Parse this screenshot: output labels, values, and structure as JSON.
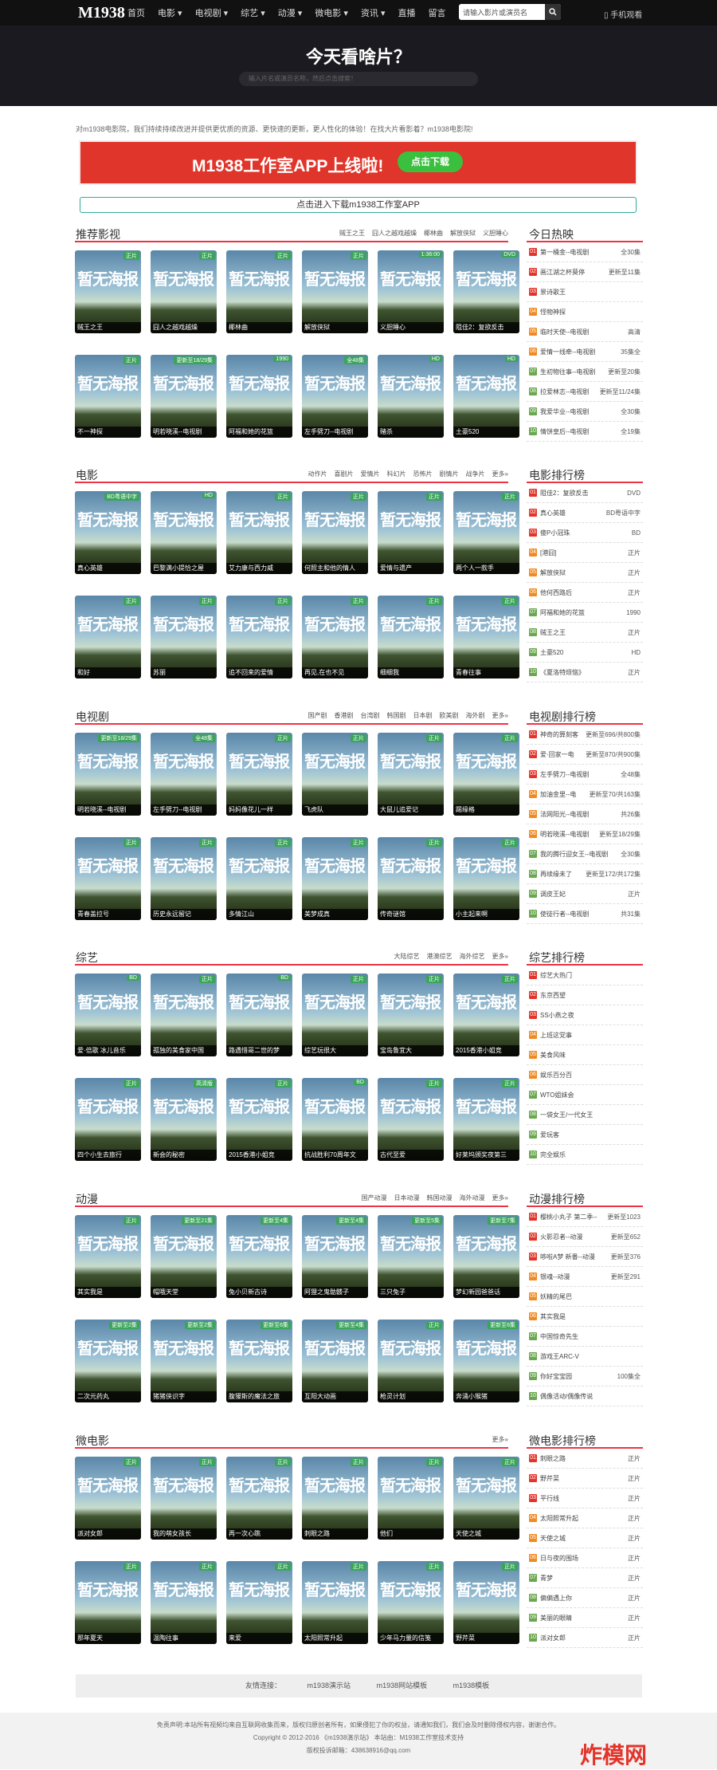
{
  "nav": {
    "logo": "M1938",
    "items": [
      "首页",
      "电影 ▾",
      "电视剧 ▾",
      "综艺 ▾",
      "动漫 ▾",
      "微电影 ▾",
      "资讯 ▾",
      "直播",
      "留言"
    ],
    "search_placeholder": "请输入影片或演员名",
    "mobile": "▯ 手机观看"
  },
  "hero": {
    "title": "今天看啥片？",
    "search": "输入片名或演员名称，然后点击搜索！"
  },
  "notice": "对m1938电影院，我们持续持续改进并提供更优质的资源、更快速的更新，更人性化的体验！在找大片看影着？m1938电影院!",
  "banner": {
    "text": "M1938工作室APP上线啦!",
    "button": "点击下载"
  },
  "download": "点击进入下载m1938工作室APP",
  "poster_text": "暂无海报",
  "sections": [
    {
      "title": "推荐影视",
      "tags": [
        "贼王之王",
        "囧人之越戏越燥",
        "椰林曲",
        "解放侠狱",
        "义胆睡心"
      ],
      "cards": [
        [
          "贼王之王",
          "正片"
        ],
        [
          "囧人之越戏越燥",
          "正片"
        ],
        [
          "椰林曲",
          "正片"
        ],
        [
          "解放侠狱",
          "正片"
        ],
        [
          "义胆睡心",
          "1:36:00"
        ],
        [
          "阻佳2：复欲反击",
          "DVD"
        ],
        [
          "不一神探",
          "正片"
        ],
        [
          "明若晓溪--电视剧",
          "更新至18/29集"
        ],
        [
          "阿福和她的花篮",
          "1990"
        ],
        [
          "左手劈刀--电视剧",
          "全48集"
        ],
        [
          "赌杀",
          "HD"
        ],
        [
          "土豪520",
          "HD"
        ]
      ]
    },
    {
      "title": "电影",
      "tags": [
        "动作片",
        "喜剧片",
        "爱情片",
        "科幻片",
        "恐怖片",
        "剧情片",
        "战争片",
        "更多»"
      ],
      "cards": [
        [
          "真心英雄",
          "BD粤语中字"
        ],
        [
          "巴黎满小提恰之屋",
          "HD"
        ],
        [
          "艾力康与西力威",
          "正片"
        ],
        [
          "何照主和他的情人",
          "正片"
        ],
        [
          "爱情与遗产",
          "正片"
        ],
        [
          "两个人一款手",
          "正片"
        ],
        [
          "和好",
          "正片"
        ],
        [
          "苏丽",
          "正片"
        ],
        [
          "追不回来的爱情",
          "正片"
        ],
        [
          "再见,在也不见",
          "正片"
        ],
        [
          "细细我",
          "正片"
        ],
        [
          "青春往事",
          "正片"
        ]
      ]
    },
    {
      "title": "电视剧",
      "tags": [
        "国产剧",
        "香港剧",
        "台湾剧",
        "韩国剧",
        "日本剧",
        "欧美剧",
        "海外剧",
        "更多»"
      ],
      "cards": [
        [
          "明若晓溪--电视剧",
          "更新至18/29集"
        ],
        [
          "左手劈刀--电视剧",
          "全48集"
        ],
        [
          "妈妈像花儿一样",
          "正片"
        ],
        [
          "飞虎队",
          "正片"
        ],
        [
          "大鼠儿追爱记",
          "正片"
        ],
        [
          "踢缘格",
          "正片"
        ],
        [
          "青春盖拉号",
          "正片"
        ],
        [
          "历史永远留记",
          "正片"
        ],
        [
          "多情江山",
          "正片"
        ],
        [
          "美梦成真",
          "正片"
        ],
        [
          "传奇谜馆",
          "正片"
        ],
        [
          "小主起来啊",
          "正片"
        ]
      ]
    },
    {
      "title": "综艺",
      "tags": [
        "大陆综艺",
        "港澳综艺",
        "海外综艺",
        "更多»"
      ],
      "cards": [
        [
          "爱·倍歌 冰儿音乐",
          "BD"
        ],
        [
          "孤独的美食家中国",
          "正片"
        ],
        [
          "路遇惜哥二世的梦",
          "BD"
        ],
        [
          "综艺玩很大",
          "正片"
        ],
        [
          "宝岛鲁宜大",
          "正片"
        ],
        [
          "2015香港小姐竞",
          "正片"
        ],
        [
          "四个小生去旅行",
          "正片"
        ],
        [
          "新会的秘密",
          "高清版"
        ],
        [
          "2015香港小姐竞",
          "正片"
        ],
        [
          "抗战胜利70周年文",
          "BD"
        ],
        [
          "古代至爱",
          "正片"
        ],
        [
          "好莱坞颁奖夜第三",
          "正片"
        ]
      ]
    },
    {
      "title": "动漫",
      "tags": [
        "国产动漫",
        "日本动漫",
        "韩国动漫",
        "海外动漫",
        "更多»"
      ],
      "cards": [
        [
          "其实我是",
          "正片"
        ],
        [
          "帽哦天堂",
          "更新至21集"
        ],
        [
          "兔小贝新古诗",
          "更新至4集"
        ],
        [
          "阿狸之鬼骷髅子",
          "更新至4集"
        ],
        [
          "三只兔子",
          "更新至5集"
        ],
        [
          "梦幻新园爸爸话",
          "更新至7集"
        ],
        [
          "二次元药丸",
          "更新至2集"
        ],
        [
          "猪猪侠识字",
          "更新至2集"
        ],
        [
          "腹獴斯的魔法之旅",
          "更新至6集"
        ],
        [
          "互阳大动画",
          "更新至4集"
        ],
        [
          "枪灵计划",
          "正片"
        ],
        [
          "奔涌小猴猪",
          "更新至6集"
        ]
      ]
    },
    {
      "title": "微电影",
      "tags": [
        "更多»"
      ],
      "cards": [
        [
          "派对女郎",
          "正片"
        ],
        [
          "我的萌女孩长",
          "正片"
        ],
        [
          "再一次心跳",
          "正片"
        ],
        [
          "刺眼之路",
          "正片"
        ],
        [
          "他们",
          "正片"
        ],
        [
          "天使之城",
          "正片"
        ],
        [
          "那年夏天",
          "正片"
        ],
        [
          "温陶往事",
          "正片"
        ],
        [
          "来爱",
          "正片"
        ],
        [
          "太阳照常升起",
          "正片"
        ],
        [
          "少年马力量的信笺",
          "正片"
        ],
        [
          "野芹菜",
          "正片"
        ]
      ]
    }
  ],
  "ranks": [
    {
      "title": "今日热映",
      "items": [
        [
          "第一桶金--电视剧",
          "全30集"
        ],
        [
          "画江湖之杯莫停",
          "更新至11集"
        ],
        [
          "景诗歌王",
          ""
        ],
        [
          "怪物神探",
          ""
        ],
        [
          "临时天使--电视剧",
          "高清"
        ],
        [
          "爱情一线牵--电视剧",
          "35集全"
        ],
        [
          "生初物往事--电视剧",
          "更新至20集"
        ],
        [
          "拉爱林志--电视剧",
          "更新至11/24集"
        ],
        [
          "我爱华业--电视剧",
          "全30集"
        ],
        [
          "情饼皇后--电视剧",
          "全19集"
        ]
      ]
    },
    {
      "title": "电影排行榜",
      "items": [
        [
          "阻佳2：复欲反击",
          "DVD"
        ],
        [
          "真心英雄",
          "BD粤语中字"
        ],
        [
          "傻P小冠珠",
          "BD"
        ],
        [
          "[港囧]",
          "正片"
        ],
        [
          "解放侠狱",
          "正片"
        ],
        [
          "他何西路后",
          "正片"
        ],
        [
          "阿福和她的花篮",
          "1990"
        ],
        [
          "贼王之王",
          "正片"
        ],
        [
          "土豪520",
          "HD"
        ],
        [
          "《夏洛特烦恼》",
          "正片"
        ]
      ]
    },
    {
      "title": "电视剧排行榜",
      "items": [
        [
          "神奇的算刻客",
          "更新至696/共800集"
        ],
        [
          "爱·回家一电",
          "更新至870/共900集"
        ],
        [
          "左手劈刀--电视剧",
          "全48集"
        ],
        [
          "加油金里--电",
          "更新至70/共163集"
        ],
        [
          "法网阳光--电视剧",
          "共26集"
        ],
        [
          "明若晓溪--电视剧",
          "更新至18/29集"
        ],
        [
          "我的腾行迎女王--电视剧",
          "全30集"
        ],
        [
          "再续缘未了",
          "更新至172/共172集"
        ],
        [
          "调皮王妃",
          "正片"
        ],
        [
          "使徒行者--电视剧",
          "共31集"
        ]
      ]
    },
    {
      "title": "综艺排行榜",
      "items": [
        [
          "综艺大热门",
          ""
        ],
        [
          "东京西望",
          ""
        ],
        [
          "SS小燕之夜",
          ""
        ],
        [
          "上班这党事",
          ""
        ],
        [
          "美食风味",
          ""
        ],
        [
          "娱乐百分百",
          ""
        ],
        [
          "WTO姐妹会",
          ""
        ],
        [
          "一袋女王/一代女王",
          ""
        ],
        [
          "爱玩客",
          ""
        ],
        [
          "完全娱乐",
          ""
        ]
      ]
    },
    {
      "title": "动漫排行榜",
      "items": [
        [
          "樱桃小丸子 第二季--",
          "更新至1023"
        ],
        [
          "火影忍者--动漫",
          "更新至652"
        ],
        [
          "哆啦A梦 新番--动漫",
          "更新至376"
        ],
        [
          "银魂--动漫",
          "更新至291"
        ],
        [
          "妖精的尾巴",
          ""
        ],
        [
          "其实我是",
          ""
        ],
        [
          "中国惊奇先生",
          ""
        ],
        [
          "游戏王ARC-V",
          ""
        ],
        [
          "你好宝宝园",
          "100集全"
        ],
        [
          "偶像活动/偶像传说",
          ""
        ]
      ]
    },
    {
      "title": "微电影排行榜",
      "items": [
        [
          "刺眼之路",
          "正片"
        ],
        [
          "野芹菜",
          "正片"
        ],
        [
          "平行线",
          "正片"
        ],
        [
          "太阳照常升起",
          "正片"
        ],
        [
          "天使之城",
          "正片"
        ],
        [
          "日与夜的围场",
          "正片"
        ],
        [
          "青梦",
          "正片"
        ],
        [
          "偏偏遇上你",
          "正片"
        ],
        [
          "美丽的眼睛",
          "正片"
        ],
        [
          "派对女郎",
          "正片"
        ]
      ]
    }
  ],
  "friend_links": {
    "label": "友情连接：",
    "links": [
      "m1938演示站",
      "m1938网站模板",
      "m1938模板"
    ]
  },
  "footer": {
    "line1": "免责声明:本站所有视频均来自互联网收集而来，版权归原创者所有，如果侵犯了你的权益，请通知我们，我们会及时删除侵权内容，谢谢合作。",
    "line2": "Copyright © 2012-2016 《m1938演示站》 本站由：M1938工作室技术支持",
    "line3": "版权投诉邮箱：438638916@qq.com"
  },
  "watermark": "炸模网"
}
